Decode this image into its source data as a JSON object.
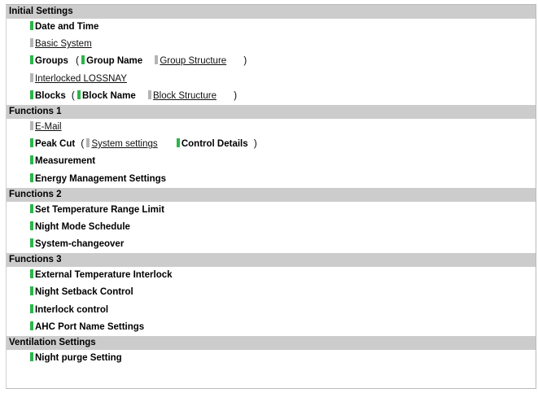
{
  "colors": {
    "section_bg": "#cccccc",
    "mark_enabled": "#2bb54a",
    "mark_disabled": "#b4b4b4"
  },
  "sections": {
    "initial": {
      "title": "Initial Settings"
    },
    "functions1": {
      "title": "Functions 1"
    },
    "functions2": {
      "title": "Functions 2"
    },
    "functions3": {
      "title": "Functions 3"
    },
    "ventilation": {
      "title": "Ventilation Settings"
    }
  },
  "items": {
    "date_time": "Date and Time",
    "basic_system": "Basic System",
    "groups": "Groups",
    "group_name": "Group Name",
    "group_structure": "Group Structure",
    "interlocked_lossnay": "Interlocked LOSSNAY",
    "blocks": "Blocks",
    "block_name": "Block Name",
    "block_structure": "Block Structure",
    "email": "E-Mail",
    "peak_cut": "Peak Cut",
    "system_settings": "System settings",
    "control_details": "Control Details",
    "measurement": "Measurement",
    "energy_mgmt": "Energy Management Settings",
    "set_temp_range": "Set Temperature Range Limit",
    "night_mode": "Night Mode Schedule",
    "system_changeover": "System-changeover",
    "ext_temp_interlock": "External Temperature Interlock",
    "night_setback": "Night Setback Control",
    "interlock_control": "Interlock control",
    "ahc_port": "AHC Port Name Settings",
    "night_purge": "Night purge Setting"
  },
  "punct": {
    "open": "(",
    "close": ")"
  }
}
